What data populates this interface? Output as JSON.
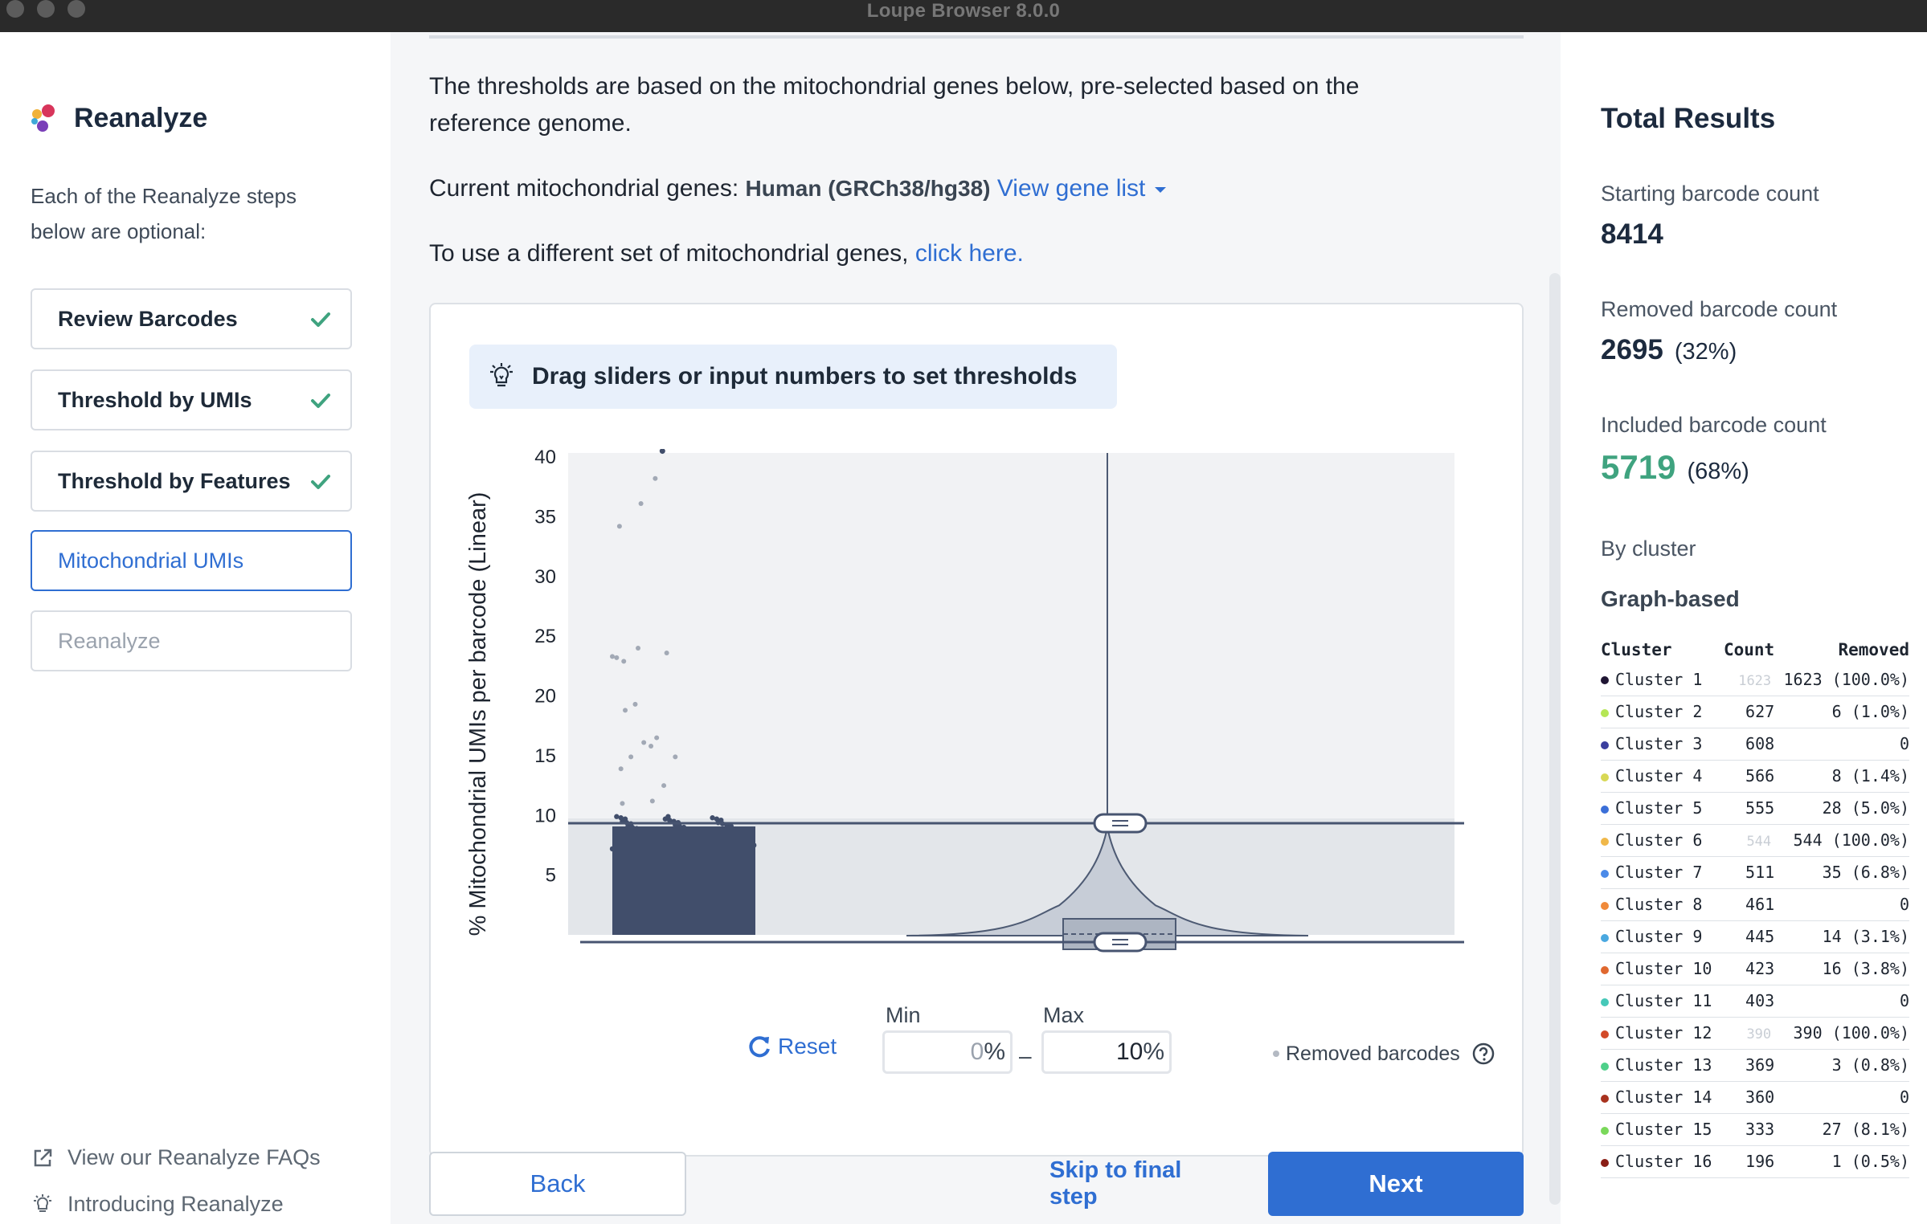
{
  "window": {
    "title": "Loupe Browser 8.0.0"
  },
  "sidebar": {
    "title": "Reanalyze",
    "intro": "Each of the Reanalyze steps below are optional:",
    "steps": [
      {
        "label": "Review Barcodes",
        "state": "done"
      },
      {
        "label": "Threshold by UMIs",
        "state": "done"
      },
      {
        "label": "Threshold by Features",
        "state": "done"
      },
      {
        "label": "Mitochondrial UMIs",
        "state": "active"
      },
      {
        "label": "Reanalyze",
        "state": "disabled"
      }
    ],
    "faq_link": "View our Reanalyze FAQs",
    "intro_link": "Introducing Reanalyze"
  },
  "main": {
    "desc_line1": "The thresholds are based on the mitochondrial genes below, pre-selected based on the",
    "desc_line2": "reference genome.",
    "current_label": "Current mitochondrial genes:",
    "current_value": "Human (GRCh38/hg38)",
    "view_gene_list": "View gene list",
    "different_set_text": "To use a different set of mitochondrial genes,",
    "click_here": "click here.",
    "hint": "Drag sliders or input numbers to set thresholds",
    "reset_label": "Reset",
    "min_label": "Min",
    "max_label": "Max",
    "min_value": "0",
    "max_value": "10",
    "pct_symbol": "%",
    "dash": "–",
    "removed_legend": "Removed barcodes",
    "back_label": "Back",
    "skip_label": "Skip to final step",
    "next_label": "Next"
  },
  "chart_data": {
    "type": "scatter",
    "ylabel": "% Mitochondrial UMIs per barcode (Linear)",
    "y_ticks": [
      "40",
      "35",
      "30",
      "25",
      "20",
      "15",
      "10",
      "5"
    ],
    "ylim": [
      0,
      40
    ],
    "threshold_min": 0,
    "threshold_max": 10,
    "outlier_points": [
      {
        "x": 0.35,
        "y": 40.5
      },
      {
        "x": 0.3,
        "y": 38.2
      },
      {
        "x": 0.2,
        "y": 36.1
      },
      {
        "x": 0.05,
        "y": 34.2
      },
      {
        "x": 0.18,
        "y": 24.0
      },
      {
        "x": 0.0,
        "y": 23.3
      },
      {
        "x": 0.03,
        "y": 23.2
      },
      {
        "x": 0.08,
        "y": 22.9
      },
      {
        "x": 0.38,
        "y": 23.6
      },
      {
        "x": 0.16,
        "y": 19.3
      },
      {
        "x": 0.09,
        "y": 18.8
      },
      {
        "x": 0.22,
        "y": 16.1
      },
      {
        "x": 0.31,
        "y": 16.5
      },
      {
        "x": 0.27,
        "y": 15.8
      },
      {
        "x": 0.44,
        "y": 14.9
      },
      {
        "x": 0.13,
        "y": 14.9
      },
      {
        "x": 0.06,
        "y": 13.9
      },
      {
        "x": 0.36,
        "y": 12.5
      },
      {
        "x": 0.28,
        "y": 11.2
      },
      {
        "x": 0.07,
        "y": 11.0
      }
    ],
    "violin": {
      "median": 1.6,
      "q1": 0.8,
      "q3": 2.6,
      "max": 9.0
    }
  },
  "results": {
    "title": "Total Results",
    "starting_label": "Starting barcode count",
    "starting_value": "8414",
    "removed_label": "Removed barcode count",
    "removed_value": "2695",
    "removed_pct": "(32%)",
    "included_label": "Included barcode count",
    "included_value": "5719",
    "included_pct": "(68%)",
    "by_cluster_label": "By cluster",
    "graph_label": "Graph-based",
    "table_headers": [
      "Cluster",
      "Count",
      "Removed"
    ],
    "clusters": [
      {
        "name": "Cluster 1",
        "count": "1623",
        "removed": "1623 (100.0%)",
        "faint": true,
        "color": "#1f1533"
      },
      {
        "name": "Cluster 2",
        "count": "627",
        "removed": "6 (1.0%)",
        "faint": false,
        "color": "#b5e655"
      },
      {
        "name": "Cluster 3",
        "count": "608",
        "removed": "0",
        "faint": false,
        "color": "#3b3f9e"
      },
      {
        "name": "Cluster 4",
        "count": "566",
        "removed": "8 (1.4%)",
        "faint": false,
        "color": "#d8d855"
      },
      {
        "name": "Cluster 5",
        "count": "555",
        "removed": "28 (5.0%)",
        "faint": false,
        "color": "#3b6fd8"
      },
      {
        "name": "Cluster 6",
        "count": "544",
        "removed": "544 (100.0%)",
        "faint": true,
        "color": "#f0b84a"
      },
      {
        "name": "Cluster 7",
        "count": "511",
        "removed": "35 (6.8%)",
        "faint": false,
        "color": "#4b8ae8"
      },
      {
        "name": "Cluster 8",
        "count": "461",
        "removed": "0",
        "faint": false,
        "color": "#f08a3a"
      },
      {
        "name": "Cluster 9",
        "count": "445",
        "removed": "14 (3.1%)",
        "faint": false,
        "color": "#4aa8e0"
      },
      {
        "name": "Cluster 10",
        "count": "423",
        "removed": "16 (3.8%)",
        "faint": false,
        "color": "#e0682f"
      },
      {
        "name": "Cluster 11",
        "count": "403",
        "removed": "0",
        "faint": false,
        "color": "#45c8b8"
      },
      {
        "name": "Cluster 12",
        "count": "390",
        "removed": "390 (100.0%)",
        "faint": true,
        "color": "#d24a28"
      },
      {
        "name": "Cluster 13",
        "count": "369",
        "removed": "3 (0.8%)",
        "faint": false,
        "color": "#4fd08a"
      },
      {
        "name": "Cluster 14",
        "count": "360",
        "removed": "0",
        "faint": false,
        "color": "#a8321e"
      },
      {
        "name": "Cluster 15",
        "count": "333",
        "removed": "27 (8.1%)",
        "faint": false,
        "color": "#7ad85a"
      },
      {
        "name": "Cluster 16",
        "count": "196",
        "removed": "1 (0.5%)",
        "faint": false,
        "color": "#8a1e16"
      }
    ]
  },
  "colors": {
    "accent": "#2f6ed2",
    "success": "#3fa37f",
    "points": "#414e6b"
  }
}
